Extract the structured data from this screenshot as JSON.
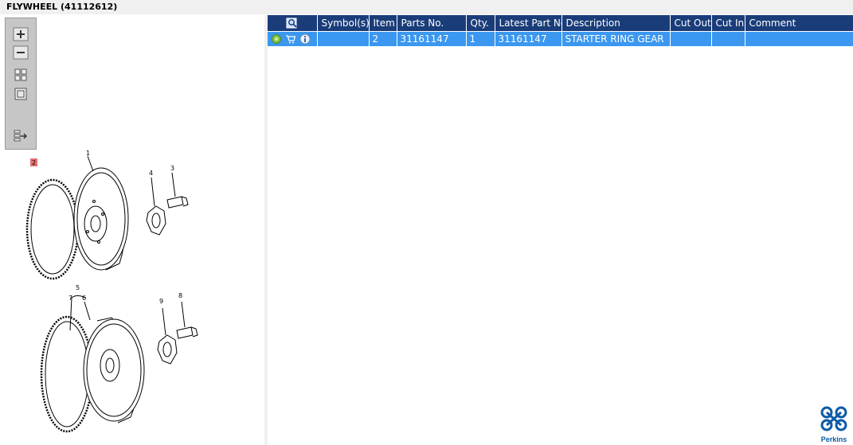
{
  "window": {
    "title": "FLYWHEEL (41112612)"
  },
  "toolbar": {
    "buttons": [
      {
        "icon": "zoom-in-icon"
      },
      {
        "icon": "zoom-out-icon"
      },
      {
        "icon": "fit-all-icon"
      },
      {
        "icon": "actual-size-icon"
      },
      {
        "icon": "export-list-icon"
      }
    ]
  },
  "diagram": {
    "callouts": [
      "1",
      "2",
      "3",
      "4",
      "5",
      "6",
      "7",
      "8",
      "9"
    ],
    "highlighted_callout": "2",
    "highlight_color": "#e87070"
  },
  "table": {
    "columns": [
      "",
      "Symbol(s)",
      "Item",
      "Parts No.",
      "Qty.",
      "Latest Part No.",
      "Description",
      "Cut Out",
      "Cut In",
      "Comment"
    ],
    "rows": [
      {
        "icons": [
          "add-to-cart-icon",
          "cart-icon",
          "info-icon"
        ],
        "symbols": "",
        "item": "2",
        "parts_no": "31161147",
        "qty": "1",
        "latest_part_no": "31161147",
        "description": "STARTER RING GEAR",
        "cut_out": "",
        "cut_in": "",
        "comment": ""
      }
    ]
  },
  "logo": {
    "text": "Perkins"
  },
  "colors": {
    "header_bg": "#1a3d7a",
    "selected_row": "#3b97ef",
    "brand": "#0e5aa7"
  }
}
